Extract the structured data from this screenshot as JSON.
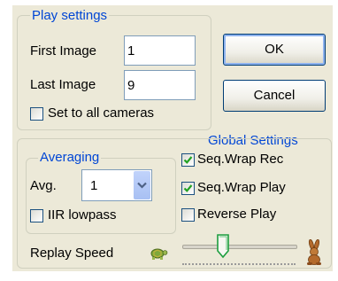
{
  "play_settings": {
    "title": "Play settings",
    "first_image_label": "First Image",
    "first_image_value": "1",
    "last_image_label": "Last Image",
    "last_image_value": "9",
    "all_cameras_label": "Set to all cameras",
    "all_cameras_checked": false
  },
  "buttons": {
    "ok": "OK",
    "cancel": "Cancel"
  },
  "averaging": {
    "title": "Averaging",
    "avg_label": "Avg.",
    "avg_value": "1",
    "iir_label": "IIR lowpass",
    "iir_checked": false
  },
  "global_settings": {
    "title": "Global Settings",
    "seq_wrap_rec_label": "Seq.Wrap Rec",
    "seq_wrap_rec_checked": true,
    "seq_wrap_play_label": "Seq.Wrap Play",
    "seq_wrap_play_checked": true,
    "reverse_play_label": "Reverse Play",
    "reverse_play_checked": false
  },
  "replay": {
    "label": "Replay Speed",
    "slow_icon": "turtle-icon",
    "fast_icon": "rabbit-icon",
    "speed_fraction": 0.36
  },
  "colors": {
    "group_title": "#0046d5",
    "dialog_bg": "#ece9d8",
    "check_mark": "#21a121"
  }
}
